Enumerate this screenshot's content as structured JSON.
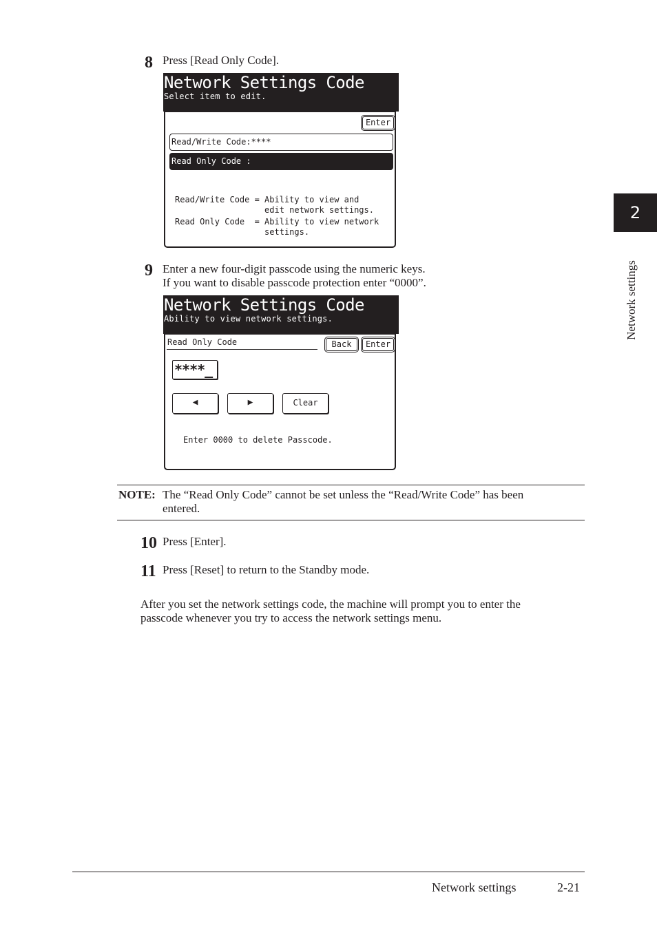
{
  "steps": [
    {
      "number": "8",
      "lines": [
        "Press [Read Only Code]."
      ]
    },
    {
      "number": "9",
      "lines": [
        "Enter a new four-digit passcode using the numeric keys.",
        "If you want to disable passcode protection enter “0000”."
      ]
    },
    {
      "number": "10",
      "lines": [
        "Press [Enter]."
      ]
    },
    {
      "number": "11",
      "lines": [
        "Press [Reset] to return to the Standby mode."
      ]
    }
  ],
  "screen1": {
    "title": "Network Settings Code",
    "subtitle": "Select item to edit.",
    "enter_label": "Enter",
    "items": [
      {
        "label": "Read/Write Code:****",
        "selected": false
      },
      {
        "label": "Read Only Code :",
        "selected": true
      }
    ],
    "help_lines": [
      "Read/Write Code = Ability to view and",
      "                  edit network settings.",
      "Read Only Code  = Ability to view network",
      "                  settings."
    ]
  },
  "screen2": {
    "title": "Network Settings Code",
    "subtitle": "Ability to view network settings.",
    "field_label": "Read Only Code",
    "back_label": "Back",
    "enter_label": "Enter",
    "code_value": "****_",
    "left_arrow": "◀",
    "right_arrow": "▶",
    "clear_label": "Clear",
    "hint": "Enter 0000 to delete Passcode."
  },
  "note": {
    "label": "NOTE:",
    "lines": [
      "The “Read Only Code” cannot be set unless the “Read/Write Code” has been",
      "entered."
    ]
  },
  "closing_paragraph": [
    "After you set the network settings code, the machine will prompt you to enter the",
    "passcode whenever you try to access the network settings menu."
  ],
  "sidebar": {
    "chapter_number": "2",
    "chapter_title": "Network settings"
  },
  "footer": {
    "section": "Network settings",
    "page": "2-21"
  }
}
